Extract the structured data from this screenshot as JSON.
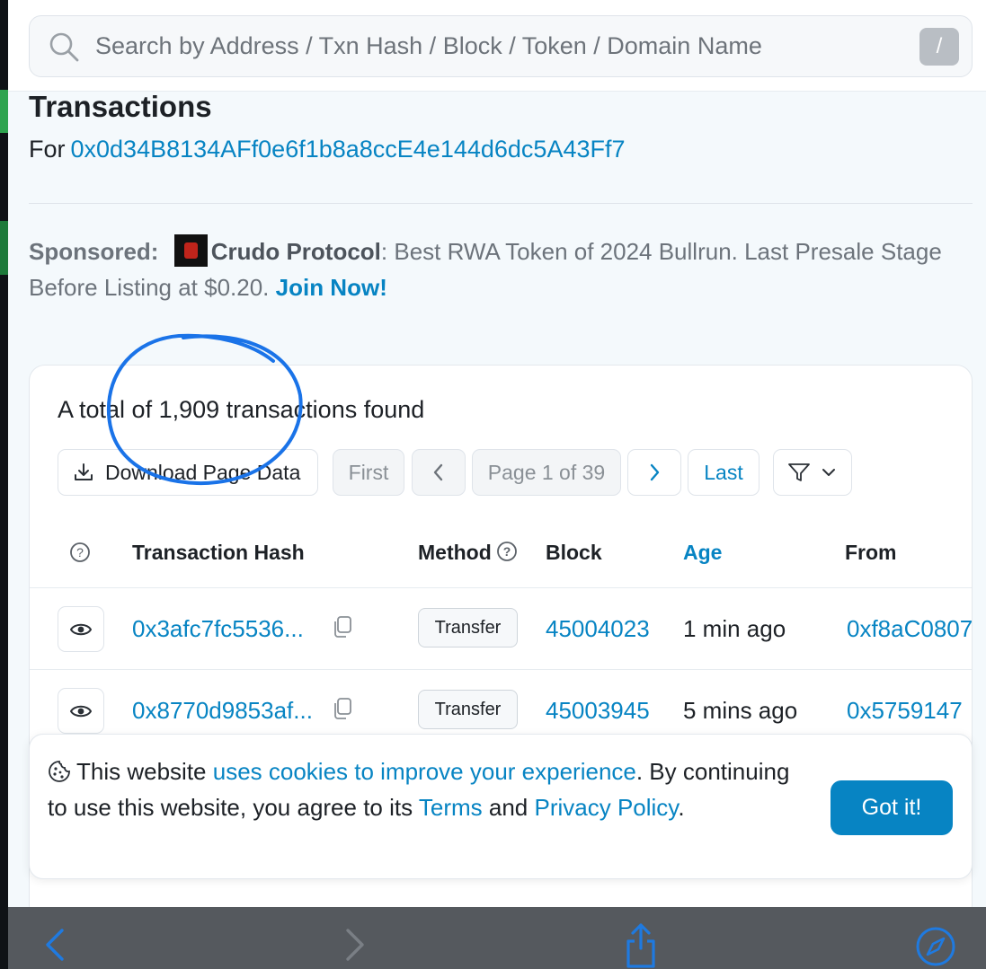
{
  "search": {
    "placeholder": "Search by Address / Txn Hash / Block / Token / Domain Name",
    "shortcut": "/"
  },
  "header": {
    "title": "Transactions",
    "for_label": "For",
    "address": "0x0d34B8134AFf0e6f1b8a8ccE4e144d6dc5A43Ff7"
  },
  "sponsored": {
    "label": "Sponsored:",
    "brand": "Crudo Protocol",
    "text": ": Best RWA Token of 2024 Bullrun. Last Presale Stage Before Listing at $0.20.",
    "cta": "Join Now!"
  },
  "results": {
    "summary": "A total of 1,909 transactions found"
  },
  "toolbar": {
    "download_label": "Download Page Data",
    "first_label": "First",
    "page_label": "Page 1 of 39",
    "last_label": "Last"
  },
  "table": {
    "columns": {
      "hash": "Transaction Hash",
      "method": "Method",
      "block": "Block",
      "age": "Age",
      "from": "From"
    },
    "rows": [
      {
        "hash": "0x3afc7fc5536...",
        "method": "Transfer",
        "block": "45004023",
        "age": "1 min ago",
        "from": "0xf8aC0807"
      },
      {
        "hash": "0x8770d9853af...",
        "method": "Transfer",
        "block": "45003945",
        "age": "5 mins ago",
        "from": "0x5759147"
      }
    ]
  },
  "cookie": {
    "t1": "This website ",
    "link1": "uses cookies to improve your experience",
    "t2": ". By continuing to use this website, you agree to its ",
    "link2": "Terms",
    "t3": " and ",
    "link3": "Privacy Policy",
    "t4": ".",
    "button": "Got it!"
  },
  "colors": {
    "link": "#0784c3",
    "annotation_circle": "#1a73e8",
    "browser_toolbar": "#55595e"
  }
}
